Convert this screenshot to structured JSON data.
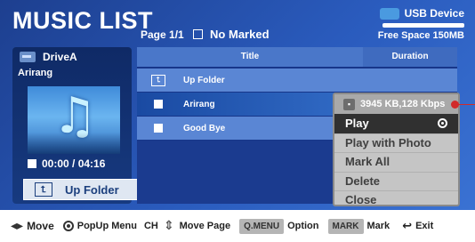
{
  "header": {
    "title": "MUSIC LIST",
    "page": "Page 1/1",
    "marked": "No Marked",
    "usb_label": "USB Device",
    "free_space": "Free Space 150MB"
  },
  "left_panel": {
    "drive_name": "DriveA",
    "song_name": "Arirang",
    "time": "00:00 / 04:16",
    "up_folder_label": "Up Folder"
  },
  "list": {
    "columns": [
      "Title",
      "Duration"
    ],
    "rows": [
      {
        "label": "Up Folder",
        "duration": "",
        "icon": "up-folder-icon"
      },
      {
        "label": "Arirang",
        "duration": "",
        "icon": "checkbox"
      },
      {
        "label": "Good Bye",
        "duration": "",
        "icon": "checkbox"
      }
    ]
  },
  "popup": {
    "info": "3945 KB,128 Kbps",
    "items": [
      "Play",
      "Play with Photo",
      "Mark All",
      "Delete",
      "Close"
    ],
    "selected": "Play"
  },
  "footer": {
    "move": "Move",
    "popup_menu": "PopUp Menu",
    "ch": "CH",
    "move_page": "Move Page",
    "qmenu_key": "Q.MENU",
    "option": "Option",
    "mark_key": "MARK",
    "mark": "Mark",
    "exit": "Exit"
  },
  "colors": {
    "background": "#2a5bbd",
    "popup_selected": "#303030",
    "pointer": "#d12a2a"
  }
}
